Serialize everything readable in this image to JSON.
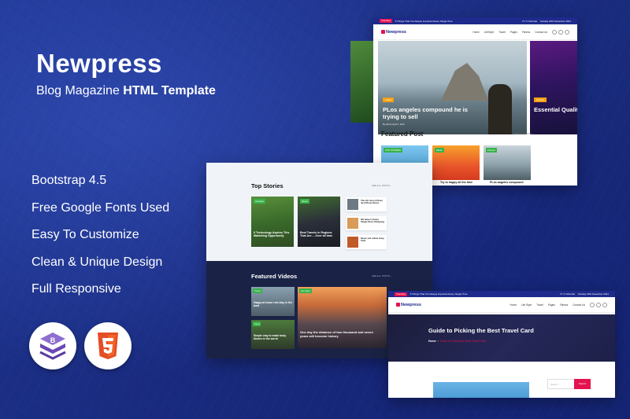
{
  "hero": {
    "title": "Newpress",
    "subtitle_light": "Blog Magazine",
    "subtitle_bold": "HTML Template"
  },
  "features": [
    "Bootstrap 4.5",
    "Free Google Fonts Used",
    "Easy To Customize",
    "Clean & Unique Design",
    "Full Responsive"
  ],
  "badges": [
    {
      "name": "bootstrap-logo",
      "color": "#7952b3"
    },
    {
      "name": "html5-logo",
      "color": "#e44d26"
    }
  ],
  "preview": {
    "trending_label": "Trending",
    "trending_text": "5 Things That You Deeply Important Every Single Time",
    "weather": "71 °C Mumbai",
    "date": "Sunday 15th November 2021",
    "logo": "Newpress",
    "nav": [
      "Home",
      "Life Style",
      "Travel",
      "Pages",
      "Fitness",
      "Contact Us"
    ],
    "nav_short": [
      "Home",
      "LifeStyle",
      "Travel",
      "Pages",
      "Fitness",
      "Contact Us"
    ],
    "hero_post": {
      "category": "Travel",
      "title": "PLos angeles compound he is trying to sell",
      "meta": "By admin   April 3, 2021"
    },
    "side_post": {
      "category": "Fitness",
      "title": "Essential Qualities Successful Music"
    },
    "featured_title": "Featured Post",
    "view_all": "SEE ALL POSTS →",
    "featured": [
      {
        "category": "TOP STORIES",
        "caption": ""
      },
      {
        "category": "Music",
        "caption": "Try to happy all the time"
      },
      {
        "category": "Fitness",
        "caption": "PLos angeles compound"
      }
    ],
    "top_stories_title": "Top Stories",
    "stories": [
      {
        "category": "Lifestyle",
        "caption": "5 Technology Aspires This Marketing Opportunity"
      },
      {
        "category": "Music",
        "caption": "Best Travels in Regions That Are ... Over all time"
      }
    ],
    "mini_stories": [
      "This Kit Just A Photo Just Photo Shoot",
      "We Have Is Every Single Story Shopping",
      "Never sell online Sony Sold"
    ],
    "meta_date": "April 3, 2021",
    "meta_admin": "By admin",
    "featured_videos_title": "Featured Videos",
    "videos": [
      {
        "category": "Travel",
        "caption": "Happy at home rest stay in the boat"
      },
      {
        "category": "Life Style",
        "caption": "One day the distance of two thousand and seven years will become history"
      },
      {
        "category": "Food",
        "caption": "Simple way to make tasty dishes in the world"
      }
    ],
    "article_title": "Guide to Picking the Best Travel Card",
    "breadcrumb_home": "Home",
    "breadcrumb_current": "Guide to Picking the Best Travel Card",
    "search_placeholder": "Search",
    "search_button": "Search"
  },
  "colors": {
    "background": "#1a2f86",
    "brand": "#1e2a8c",
    "accent": "#e4134f",
    "category_tag": "#37b34a",
    "highlight": "#f4a012"
  }
}
